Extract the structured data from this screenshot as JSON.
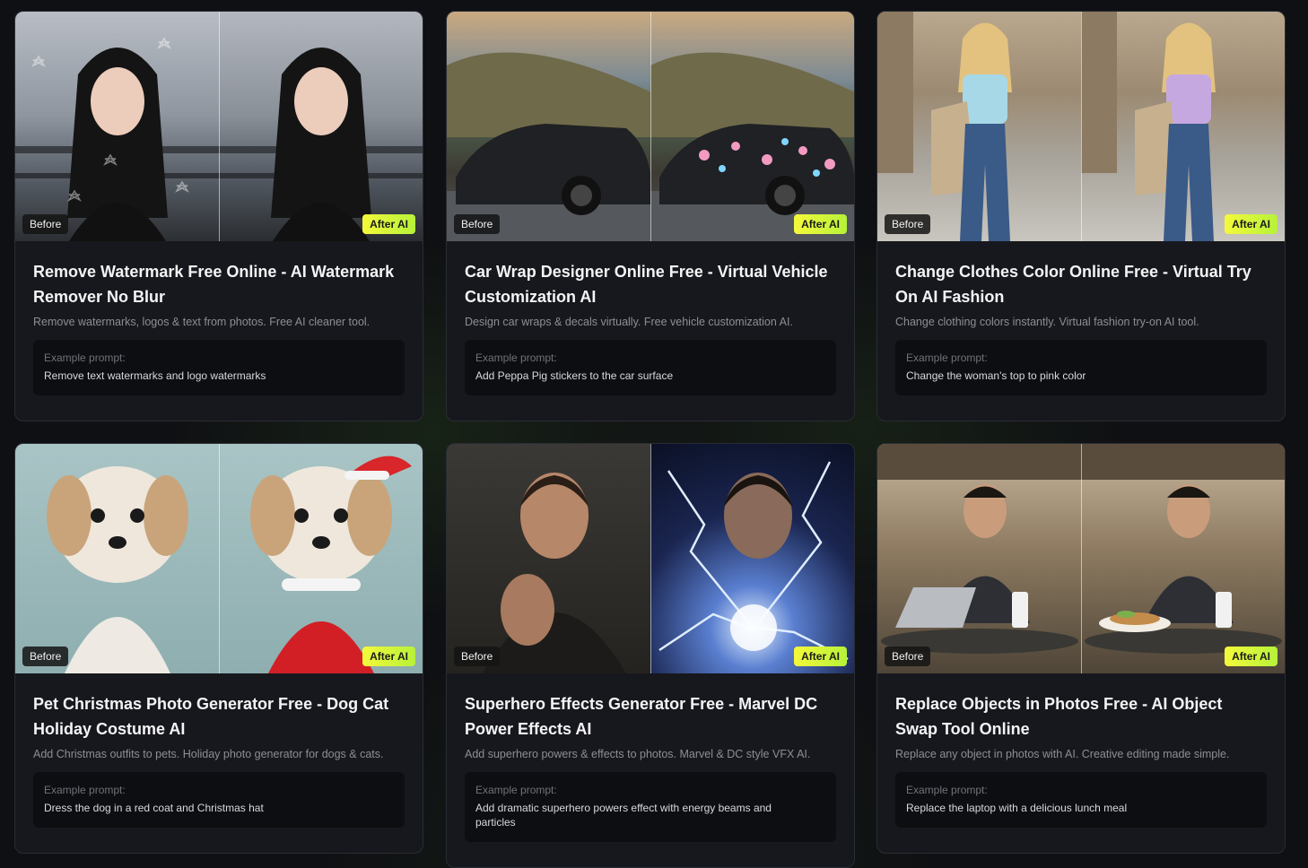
{
  "badges": {
    "before": "Before",
    "after": "After AI"
  },
  "prompt_label": "Example prompt:",
  "cards": [
    {
      "title": "Remove Watermark Free Online - AI Watermark Remover No Blur",
      "description": "Remove watermarks, logos & text from photos. Free AI cleaner tool.",
      "prompt": "Remove text watermarks and logo watermarks"
    },
    {
      "title": "Car Wrap Designer Online Free - Virtual Vehicle Customization AI",
      "description": "Design car wraps & decals virtually. Free vehicle customization AI.",
      "prompt": "Add Peppa Pig stickers to the car surface"
    },
    {
      "title": "Change Clothes Color Online Free - Virtual Try On AI Fashion",
      "description": "Change clothing colors instantly. Virtual fashion try-on AI tool.",
      "prompt": "Change the woman's top to pink color"
    },
    {
      "title": "Pet Christmas Photo Generator Free - Dog Cat Holiday Costume AI",
      "description": "Add Christmas outfits to pets. Holiday photo generator for dogs & cats.",
      "prompt": "Dress the dog in a red coat and Christmas hat"
    },
    {
      "title": "Superhero Effects Generator Free - Marvel DC Power Effects AI",
      "description": "Add superhero powers & effects to photos. Marvel & DC style VFX AI.",
      "prompt": "Add dramatic superhero powers effect with energy beams and particles"
    },
    {
      "title": "Replace Objects in Photos Free - AI Object Swap Tool Online",
      "description": "Replace any object in photos with AI. Creative editing made simple.",
      "prompt": "Replace the laptop with a delicious lunch meal"
    }
  ]
}
